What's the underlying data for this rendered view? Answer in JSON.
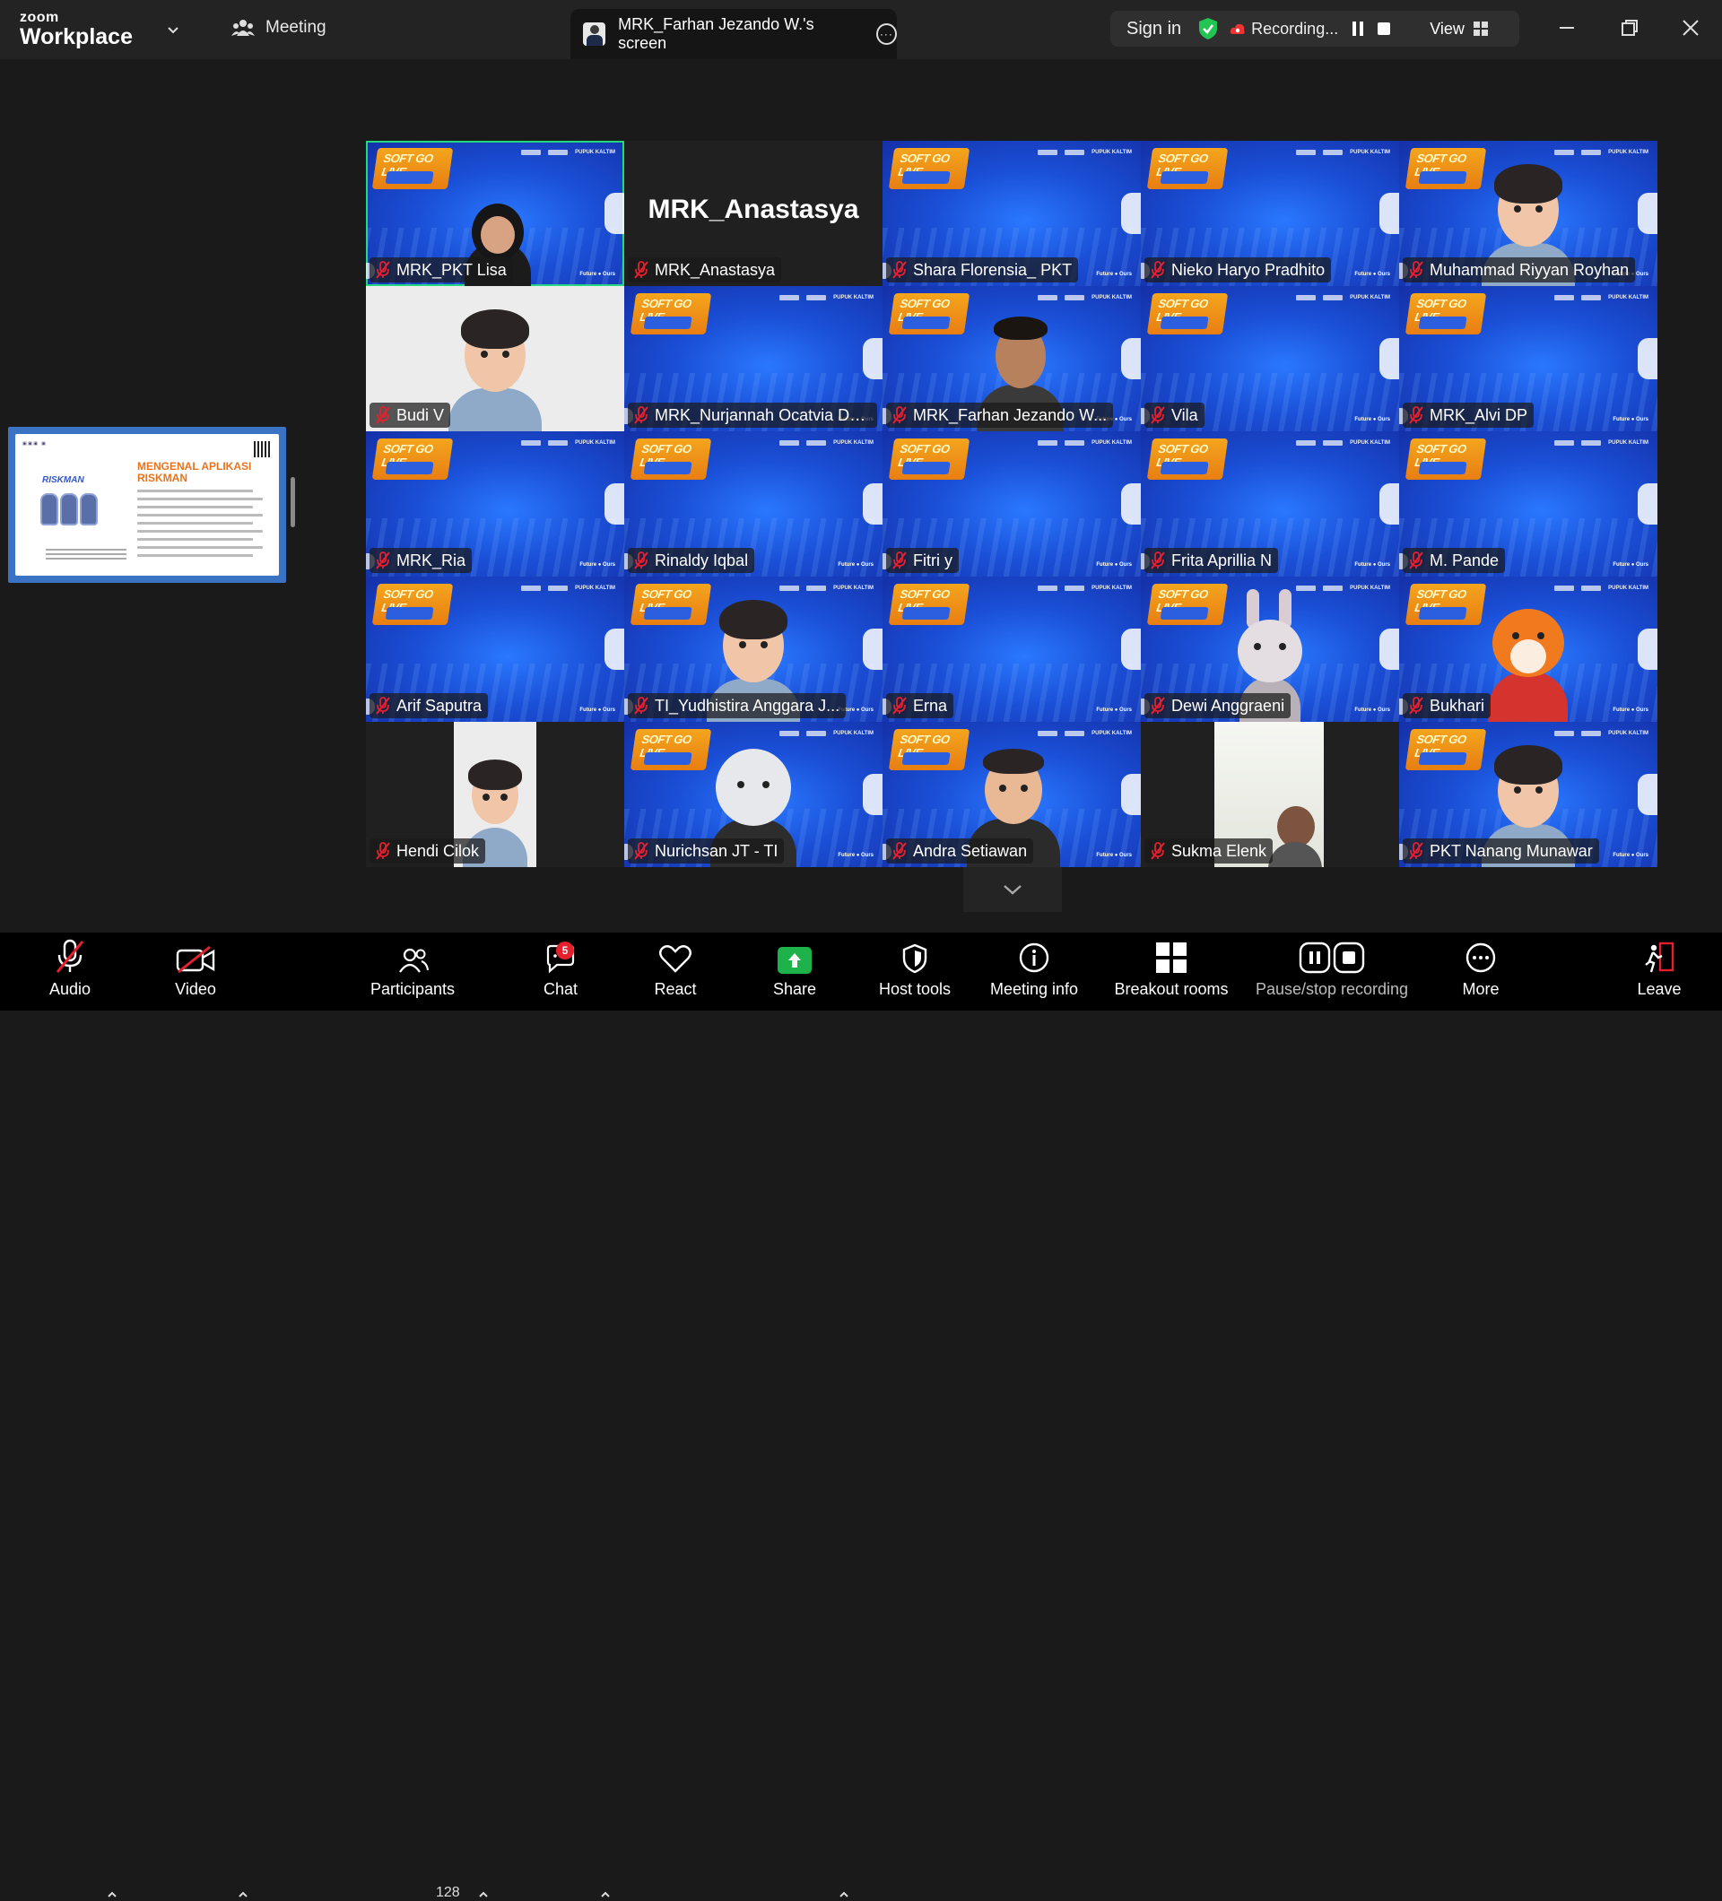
{
  "app": {
    "brand_top": "zoom",
    "brand_bottom": "Workplace",
    "meeting_tab": "Meeting",
    "screen_tab": "MRK_Farhan Jezando W.'s screen",
    "sign_in": "Sign in",
    "recording": "Recording...",
    "view": "View"
  },
  "colors": {
    "active_speaker_border": "#23d97b",
    "muted_icon": "#e5202e",
    "share_button": "#1db34a",
    "tile_blue": "#1a4fd6"
  },
  "tile_branding": {
    "badge": "SOFT GO LIVE",
    "partner": "PUPUK KALTIM",
    "footer": "Future ● Ours"
  },
  "shared_slide": {
    "title_line1": "MENGENAL APLIKASI",
    "title_line2": "RISKMAN",
    "logo_text": "RISKMAN"
  },
  "participants": [
    {
      "name": "MRK_PKT Lisa",
      "bg": "blue",
      "avatar": "video-woman-hijab",
      "active": true
    },
    {
      "name": "MRK_Anastasya",
      "bg": "dark",
      "avatar": "name-card",
      "big_name": "MRK_Anastasya"
    },
    {
      "name": "Shara Florensia_ PKT",
      "bg": "blue"
    },
    {
      "name": "Nieko Haryo Pradhito",
      "bg": "blue"
    },
    {
      "name": "Muhammad Riyyan Royhan",
      "bg": "blue",
      "avatar": "avatar-man"
    },
    {
      "name": "Budi V",
      "bg": "light",
      "avatar": "avatar-boy"
    },
    {
      "name": "MRK_Nurjannah Ocatvia De...",
      "bg": "blue"
    },
    {
      "name": "MRK_Farhan Jezando W...",
      "bg": "blue",
      "avatar": "video-man"
    },
    {
      "name": "Vila",
      "bg": "blue"
    },
    {
      "name": "MRK_Alvi DP",
      "bg": "blue"
    },
    {
      "name": "MRK_Ria",
      "bg": "blue"
    },
    {
      "name": "Rinaldy Iqbal",
      "bg": "blue"
    },
    {
      "name": "Fitri y",
      "bg": "blue"
    },
    {
      "name": "Frita Aprillia N",
      "bg": "blue"
    },
    {
      "name": "M. Pande",
      "bg": "blue"
    },
    {
      "name": "Arif Saputra",
      "bg": "blue"
    },
    {
      "name": "TI_Yudhistira Anggara J...",
      "bg": "blue",
      "avatar": "avatar-boy"
    },
    {
      "name": "Erna",
      "bg": "blue"
    },
    {
      "name": "Dewi Anggraeni",
      "bg": "blue",
      "avatar": "avatar-rabbit"
    },
    {
      "name": "Bukhari",
      "bg": "blue",
      "avatar": "avatar-fox"
    },
    {
      "name": "Hendi Cilok",
      "bg": "dark",
      "avatar": "avatar-boy-pillar"
    },
    {
      "name": "Nurichsan JT - TI",
      "bg": "blue",
      "avatar": "avatar-bear"
    },
    {
      "name": "Andra Setiawan",
      "bg": "blue",
      "avatar": "avatar-glasses-man"
    },
    {
      "name": "Sukma Elenk",
      "bg": "dark",
      "avatar": "video-pillar"
    },
    {
      "name": "PKT Nanang Munawar",
      "bg": "blue",
      "avatar": "avatar-man"
    }
  ],
  "toolbar": {
    "audio": "Audio",
    "video": "Video",
    "participants": "Participants",
    "participants_count": "128",
    "chat": "Chat",
    "chat_badge": "5",
    "react": "React",
    "share": "Share",
    "host_tools": "Host tools",
    "meeting_info": "Meeting info",
    "breakout_rooms": "Breakout rooms",
    "pause_stop_recording": "Pause/stop recording",
    "more": "More",
    "leave": "Leave"
  }
}
